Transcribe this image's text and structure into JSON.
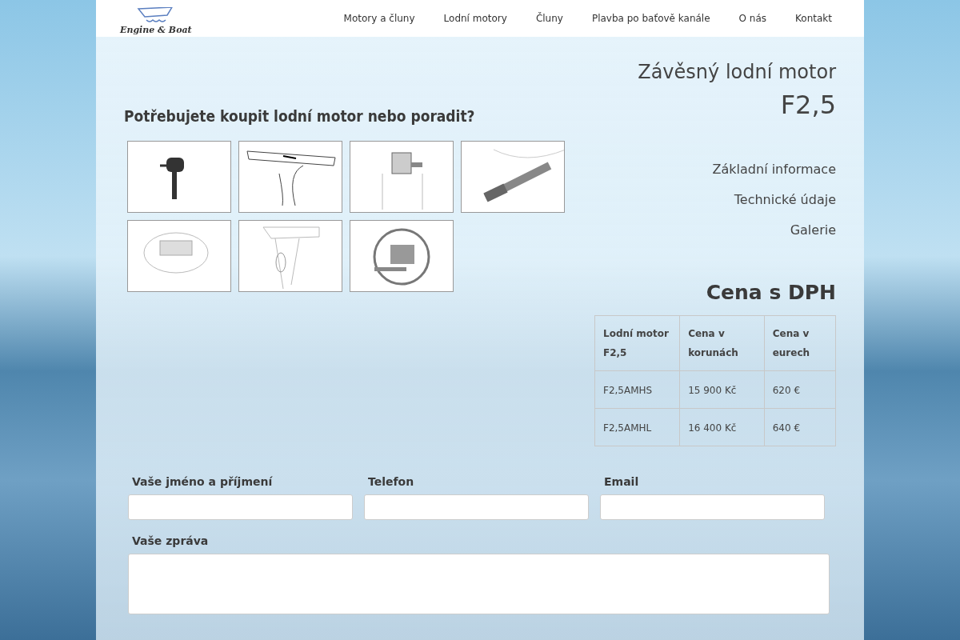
{
  "header": {
    "logo_text": "Engine & Boat",
    "nav": [
      {
        "label": "Motory a čluny"
      },
      {
        "label": "Lodní motory"
      },
      {
        "label": "Čluny"
      },
      {
        "label": "Plavba po baťově kanále"
      },
      {
        "label": "O nás"
      },
      {
        "label": "Kontakt"
      }
    ]
  },
  "product": {
    "subtitle": "Závěsný lodní motor",
    "model": "F2,5"
  },
  "gallery": {
    "heading": "Potřebujete koupit lodní motor nebo poradit?",
    "images": [
      {
        "kind": "motor"
      },
      {
        "kind": "tiller"
      },
      {
        "kind": "clamp"
      },
      {
        "kind": "handle"
      },
      {
        "kind": "cover"
      },
      {
        "kind": "propeller"
      },
      {
        "kind": "rotation"
      }
    ]
  },
  "sections": [
    {
      "label": "Základní informace"
    },
    {
      "label": "Technické údaje"
    },
    {
      "label": "Galerie"
    }
  ],
  "price": {
    "heading": "Cena s DPH",
    "columns": [
      "Lodní motor F2,5",
      "Cena v korunách",
      "Cena v eurech"
    ],
    "rows": [
      [
        "F2,5AMHS",
        "15 900 Kč",
        "620 €"
      ],
      [
        "F2,5AMHL",
        "16 400 Kč",
        "640 €"
      ]
    ]
  },
  "form": {
    "fields": [
      {
        "label": "Vaše jméno a příjmení"
      },
      {
        "label": "Telefon"
      },
      {
        "label": "Email"
      }
    ],
    "message_label": "Vaše zpráva"
  }
}
